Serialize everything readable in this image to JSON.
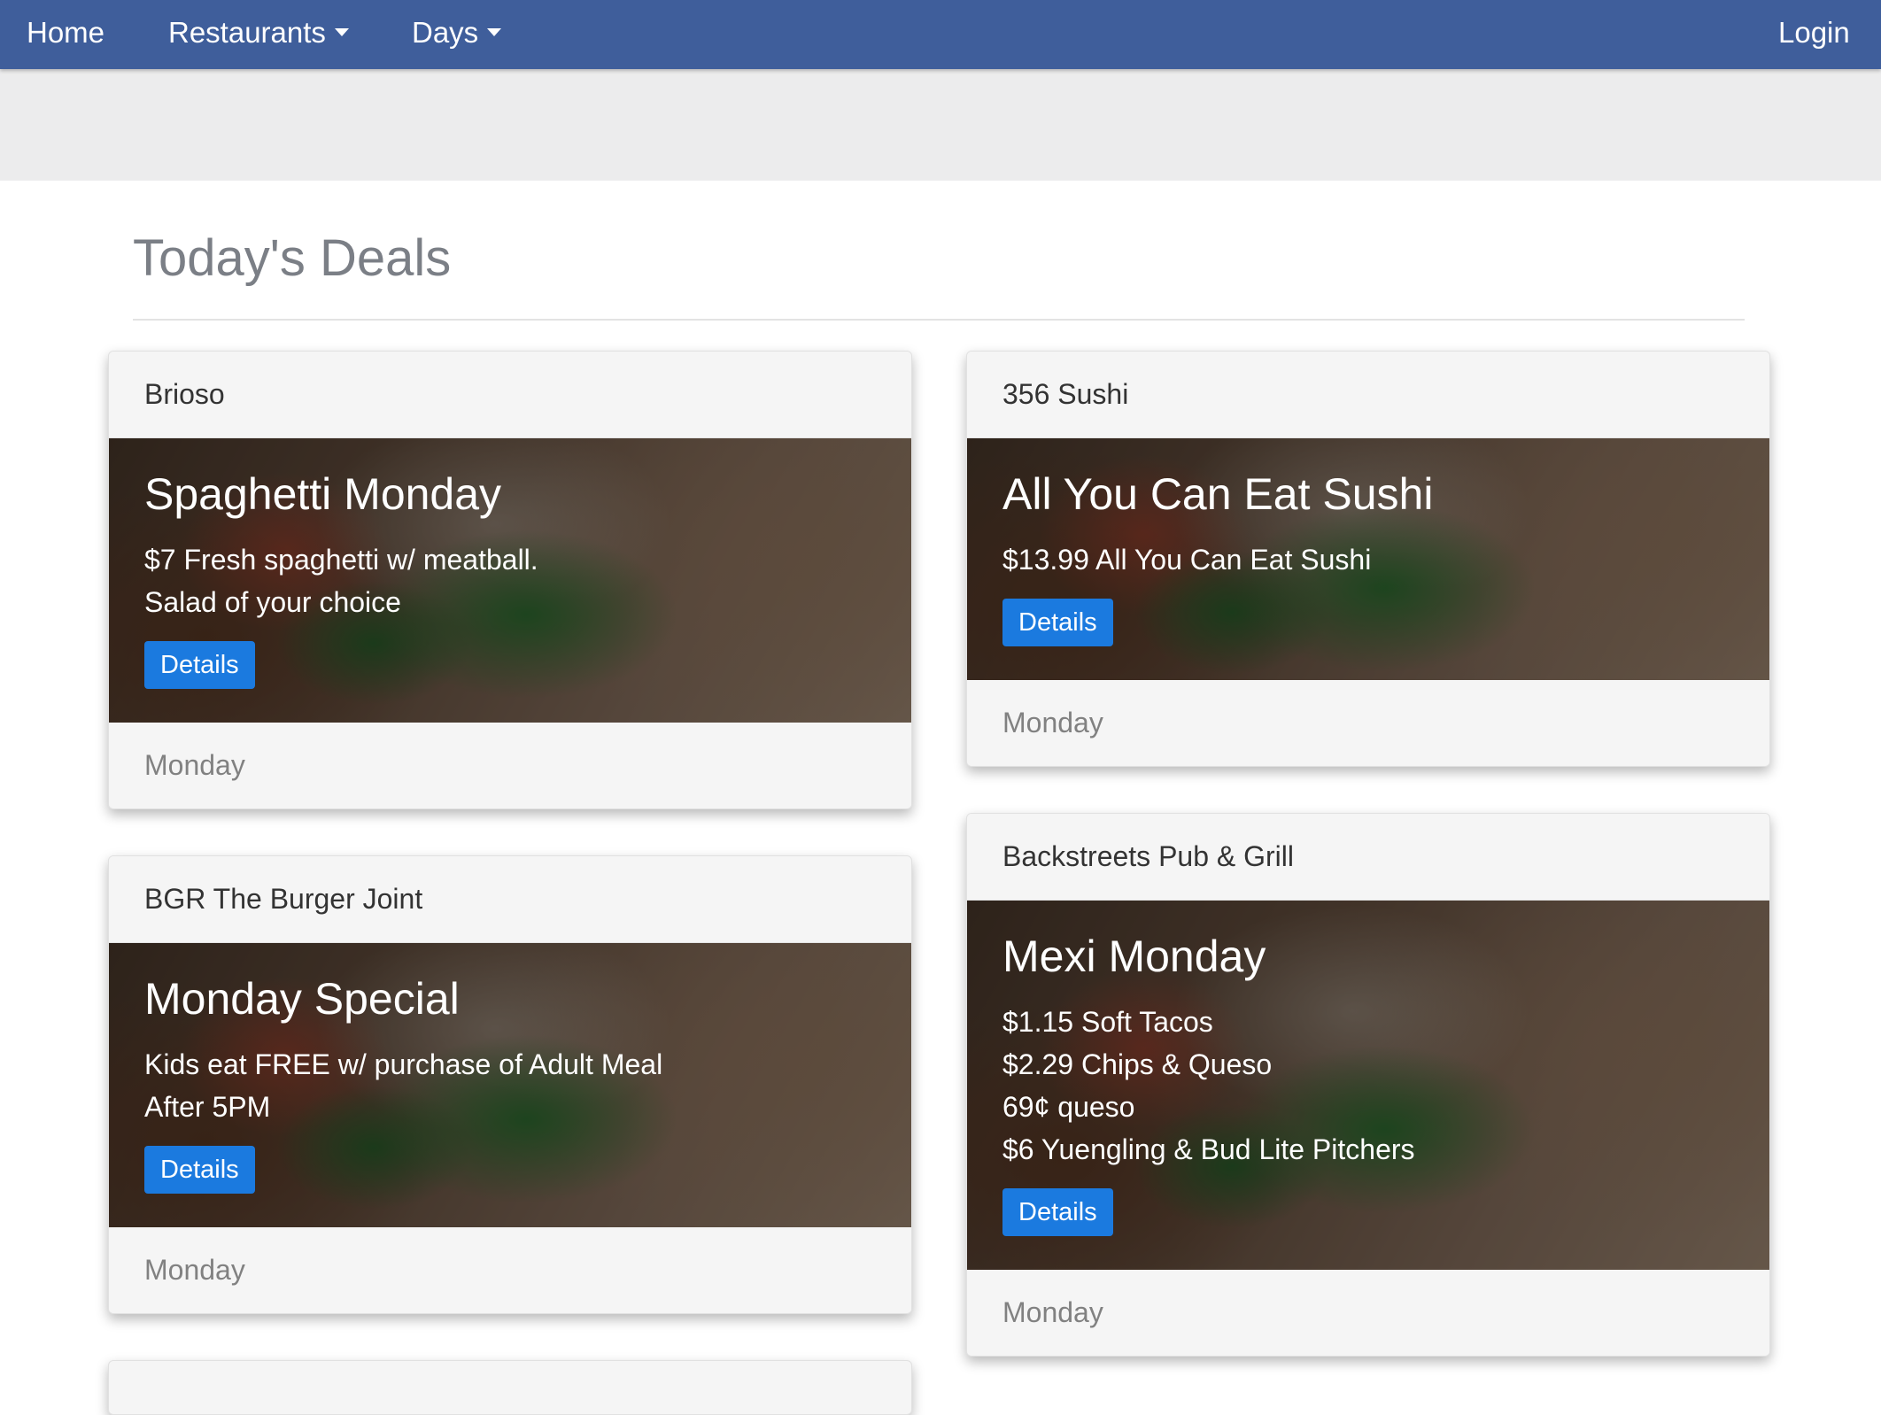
{
  "navbar": {
    "home": "Home",
    "restaurants": "Restaurants",
    "days": "Days",
    "login": "Login"
  },
  "page": {
    "title": "Today's Deals"
  },
  "cards": [
    {
      "restaurant": "Brioso",
      "deal_title": "Spaghetti Monday",
      "lines": [
        "$7 Fresh spaghetti w/ meatball.",
        "Salad of your choice"
      ],
      "button": "Details",
      "day": "Monday"
    },
    {
      "restaurant": "356 Sushi",
      "deal_title": "All You Can Eat Sushi",
      "lines": [
        "$13.99 All You Can Eat Sushi"
      ],
      "button": "Details",
      "day": "Monday"
    },
    {
      "restaurant": "BGR The Burger Joint",
      "deal_title": "Monday Special",
      "lines": [
        "Kids eat FREE w/ purchase of Adult Meal",
        "After 5PM"
      ],
      "button": "Details",
      "day": "Monday"
    },
    {
      "restaurant": "Backstreets Pub & Grill",
      "deal_title": "Mexi Monday",
      "lines": [
        "$1.15 Soft Tacos",
        "$2.29 Chips & Queso",
        "69¢ queso",
        "$6 Yuengling & Bud Lite Pitchers"
      ],
      "button": "Details",
      "day": "Monday"
    }
  ]
}
